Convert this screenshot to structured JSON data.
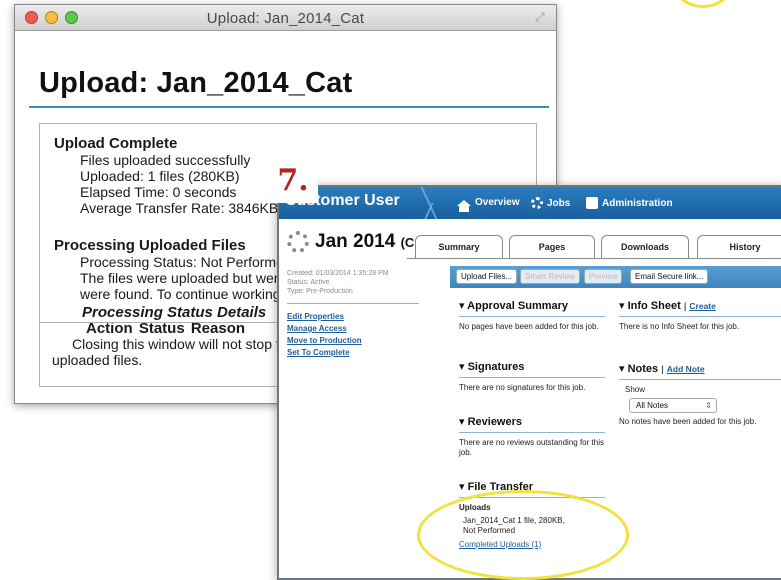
{
  "step_label": "7.",
  "upload_window": {
    "title_bar": "Upload: Jan_2014_Cat",
    "heading": "Upload: Jan_2014_Cat",
    "complete_heading": "Upload Complete",
    "complete_lines": [
      "Files uploaded successfully",
      "Uploaded: 1 files (280KB)",
      "Elapsed Time: 0 seconds",
      "Average Transfer Rate: 3846KB"
    ],
    "processing_heading": "Processing Uploaded Files",
    "processing_lines": [
      "Processing Status: Not Performe",
      "The files were uploaded but were",
      "were found. To continue working,"
    ],
    "details_heading": "Processing Status Details",
    "details_columns": "Action Status Reason",
    "footer_line1": "Closing this window will not stop th",
    "footer_line2": "uploaded files."
  },
  "app": {
    "nav": {
      "user": "Customer User",
      "items": [
        "Overview",
        "Jobs",
        "Administration"
      ]
    },
    "job_title": "Jan 2014",
    "job_title_suffix": "(C",
    "meta": [
      "Created: 01/03/2014 1:35:28 PM",
      "Status: Active",
      "Type: Pre-Production"
    ],
    "links": [
      "Edit Properties",
      "Manage Access",
      "Move to Production",
      "Set To Complete"
    ],
    "tabs": [
      "Summary",
      "Pages",
      "Downloads",
      "History"
    ],
    "buttons": [
      "Upload Files...",
      "Smart Review",
      "Preview",
      "Email Secure link..."
    ],
    "approval": {
      "title": "▾ Approval Summary",
      "text": "No pages have been added for this job."
    },
    "signatures": {
      "title": "▾ Signatures",
      "text": "There are no signatures for this job."
    },
    "reviewers": {
      "title": "▾ Reviewers",
      "text": "There are no reviews outstanding for this job."
    },
    "file_transfer": {
      "title": "▾ File Transfer",
      "uploads_label": "Uploads",
      "upload_line1": "Jan_2014_Cat 1 file, 280KB,",
      "upload_line2": "Not Performed",
      "completed_link": "Completed Uploads (1)"
    },
    "info_sheet": {
      "title": "▾ Info Sheet",
      "link": "Create",
      "text": "There is no Info Sheet for this job."
    },
    "notes": {
      "title": "▾ Notes",
      "link": "Add Note",
      "show_label": "Show",
      "select_value": "All Notes",
      "text": "No notes have been added for this job."
    }
  }
}
